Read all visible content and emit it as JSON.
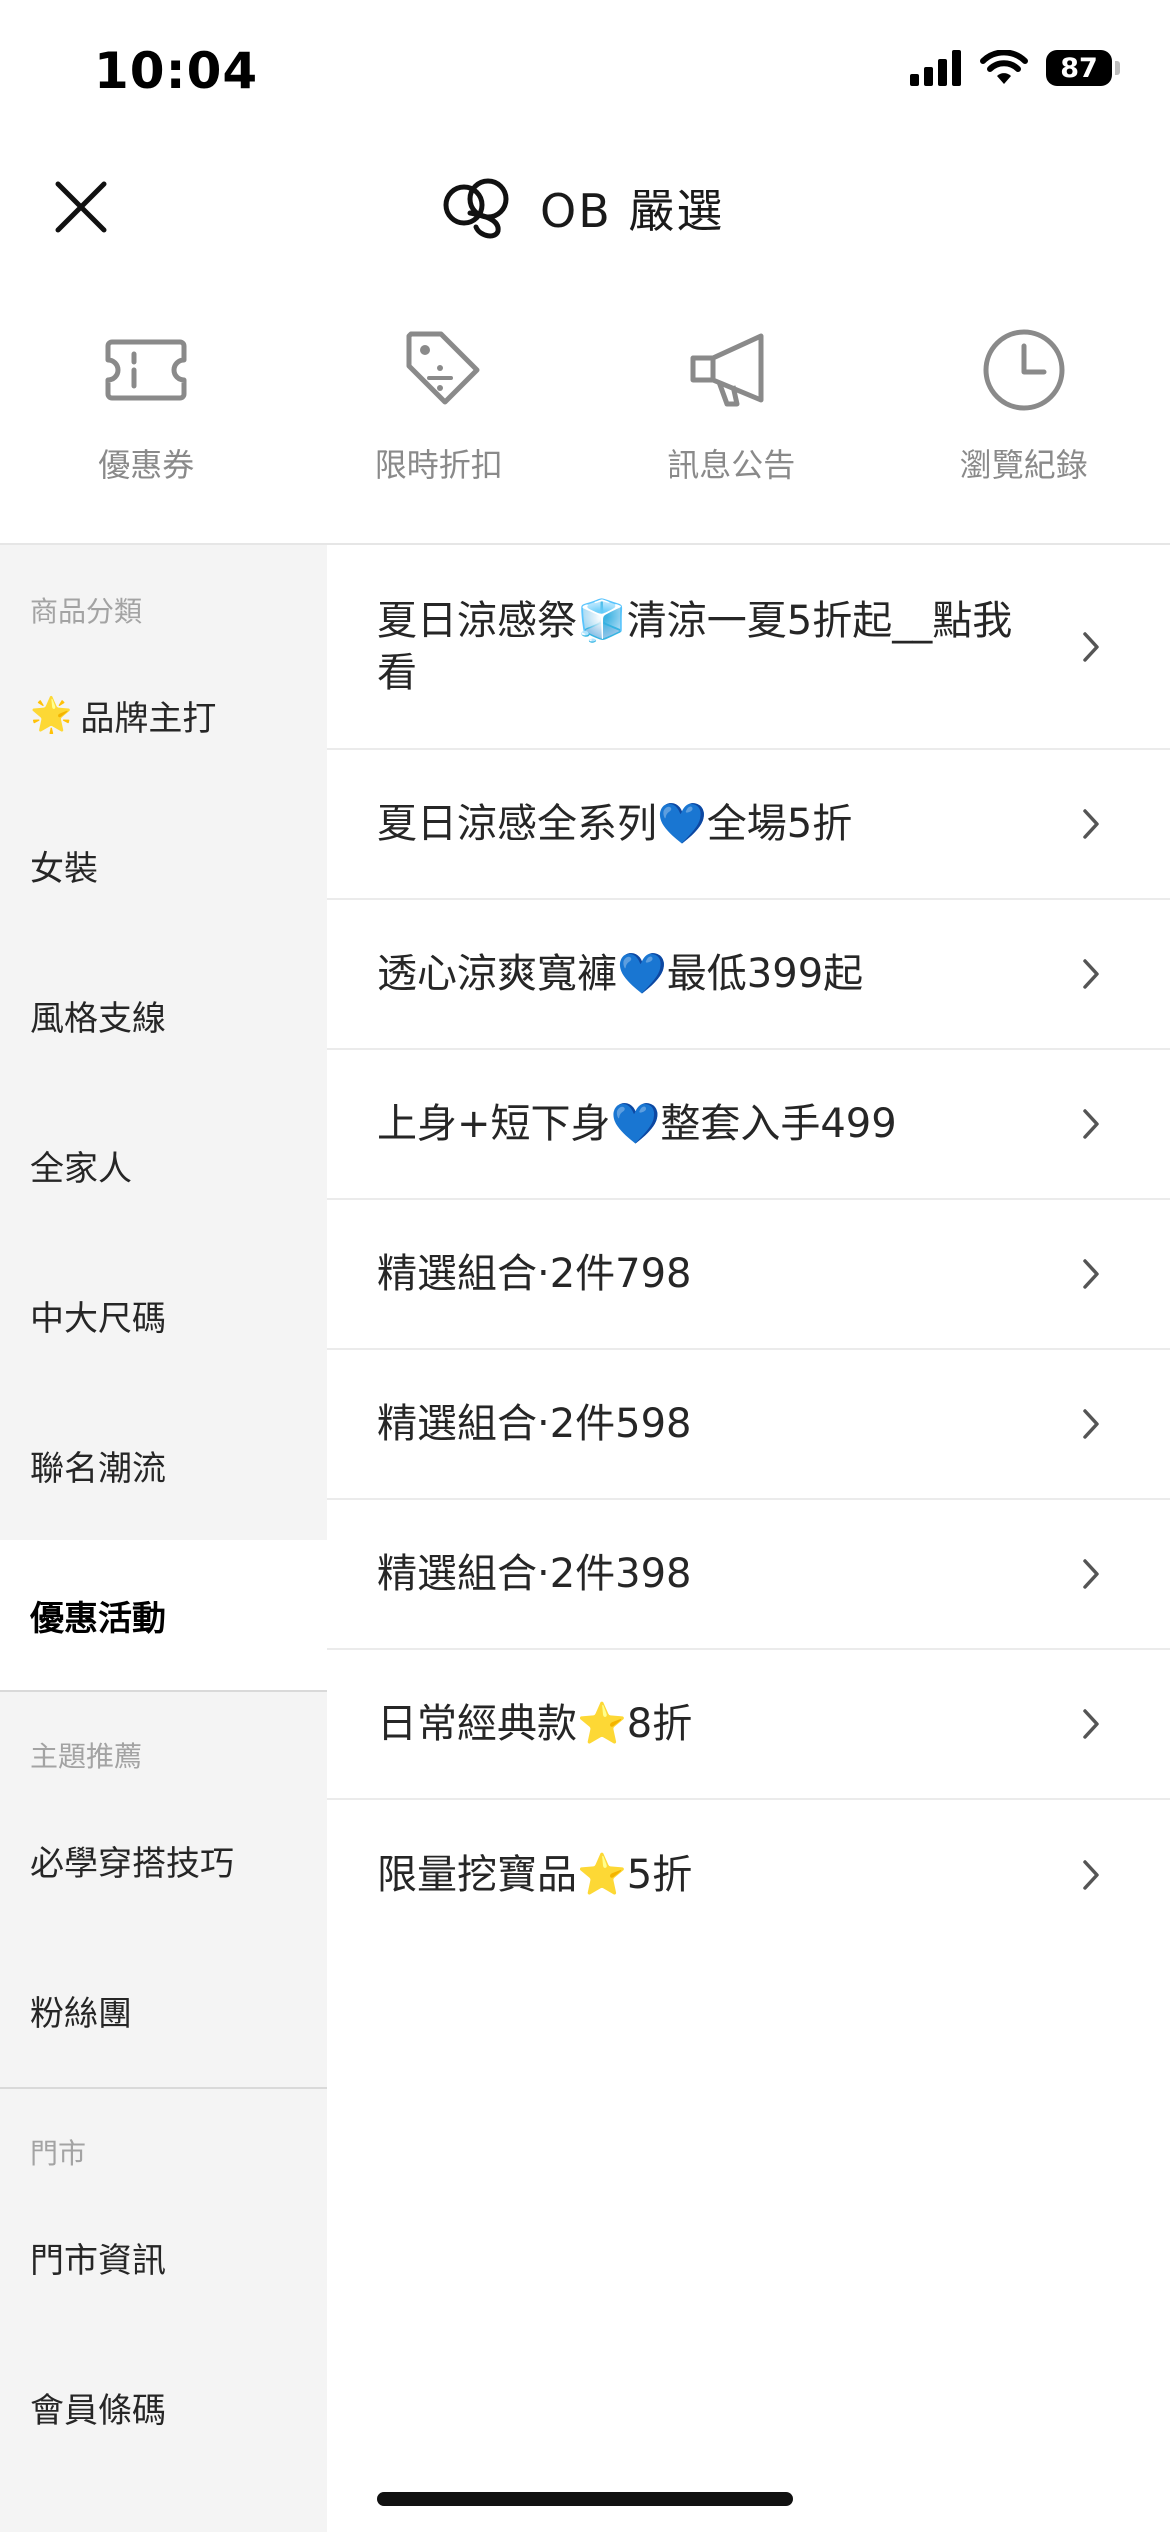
{
  "status_bar": {
    "time": "10:04",
    "battery": "87",
    "icons": [
      "signal-icon",
      "wifi-icon",
      "battery-icon"
    ]
  },
  "header": {
    "title": "OB 嚴選",
    "close_icon": "close-icon",
    "logo_icon": "brand-logo-icon"
  },
  "shortcuts": [
    {
      "label": "優惠券",
      "icon": "ticket-icon"
    },
    {
      "label": "限時折扣",
      "icon": "price-tag-icon"
    },
    {
      "label": "訊息公告",
      "icon": "megaphone-icon"
    },
    {
      "label": "瀏覽紀錄",
      "icon": "clock-icon"
    }
  ],
  "sidebar": {
    "sections": [
      {
        "title": "商品分類",
        "items": [
          {
            "label": "品牌主打",
            "emoji": "🌟"
          },
          {
            "label": "女裝"
          },
          {
            "label": "風格支線"
          },
          {
            "label": "全家人"
          },
          {
            "label": "中大尺碼"
          },
          {
            "label": "聯名潮流"
          },
          {
            "label": "優惠活動",
            "active": true
          }
        ]
      },
      {
        "title": "主題推薦",
        "items": [
          {
            "label": "必學穿搭技巧"
          },
          {
            "label": "粉絲團"
          }
        ]
      },
      {
        "title": "門市",
        "items": [
          {
            "label": "門市資訊"
          },
          {
            "label": "會員條碼"
          }
        ]
      }
    ]
  },
  "promotions": [
    {
      "label": "夏日涼感祭🧊清涼一夏5折起__點我看"
    },
    {
      "label": "夏日涼感全系列💙全場5折"
    },
    {
      "label": "透心涼爽寬褲💙最低399起"
    },
    {
      "label": "上身+短下身💙整套入手499"
    },
    {
      "label": "精選組合‧2件798"
    },
    {
      "label": "精選組合‧2件598"
    },
    {
      "label": "精選組合‧2件398"
    },
    {
      "label": "日常經典款⭐8折"
    },
    {
      "label": "限量挖寶品⭐5折"
    }
  ],
  "colors": {
    "sidebar_bg": "#f4f4f4",
    "active_bg": "#ffffff",
    "icon_gray": "#8a8a8a",
    "divider": "#ebebeb"
  }
}
